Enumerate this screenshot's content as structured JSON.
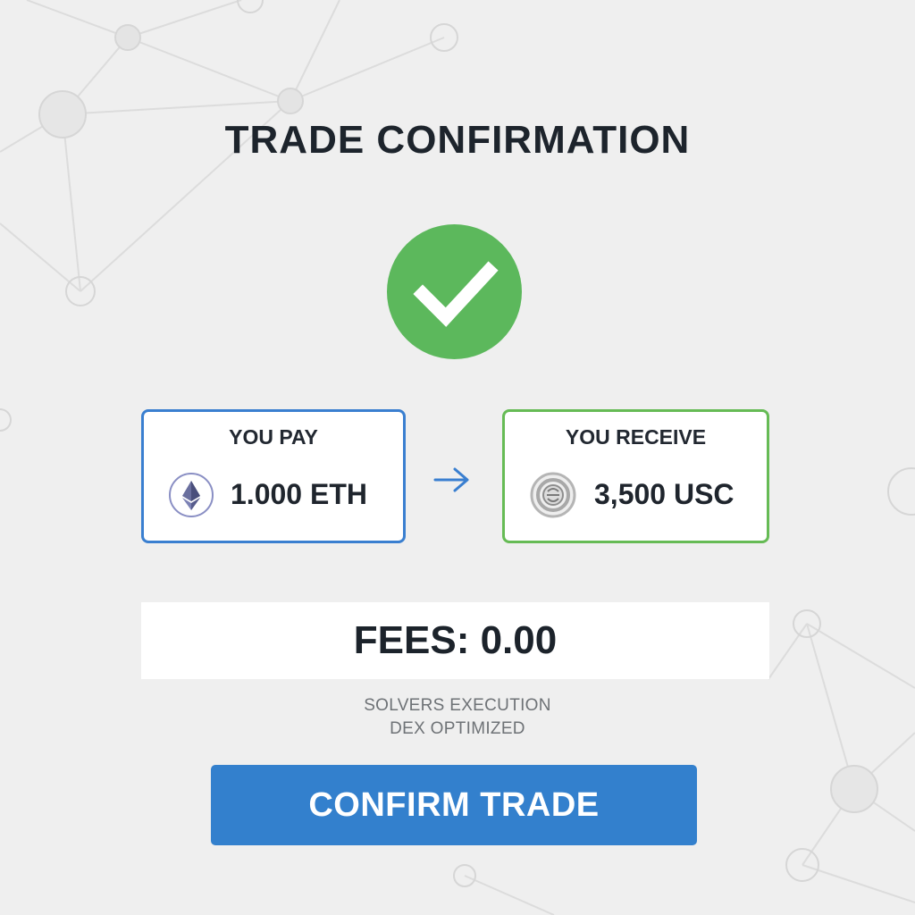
{
  "header": {
    "title": "TRADE CONFIRMATION"
  },
  "status": {
    "icon": "check-icon",
    "color": "#5cb85c"
  },
  "pay": {
    "label": "YOU PAY",
    "amount": "1.000 ETH",
    "icon": "ethereum-icon",
    "border_color": "#3a7fd0"
  },
  "swap": {
    "icon": "arrow-right-icon"
  },
  "receive": {
    "label": "YOU RECEIVE",
    "amount": "3,500 USC",
    "icon": "stablecoin-icon",
    "border_color": "#66bb55"
  },
  "fees": {
    "text": "FEES: 0.00"
  },
  "execution": {
    "line1": "SOLVERS EXECUTION",
    "line2": "DEX OPTIMIZED"
  },
  "actions": {
    "confirm_label": "CONFIRM TRADE",
    "confirm_color": "#3380cd"
  }
}
